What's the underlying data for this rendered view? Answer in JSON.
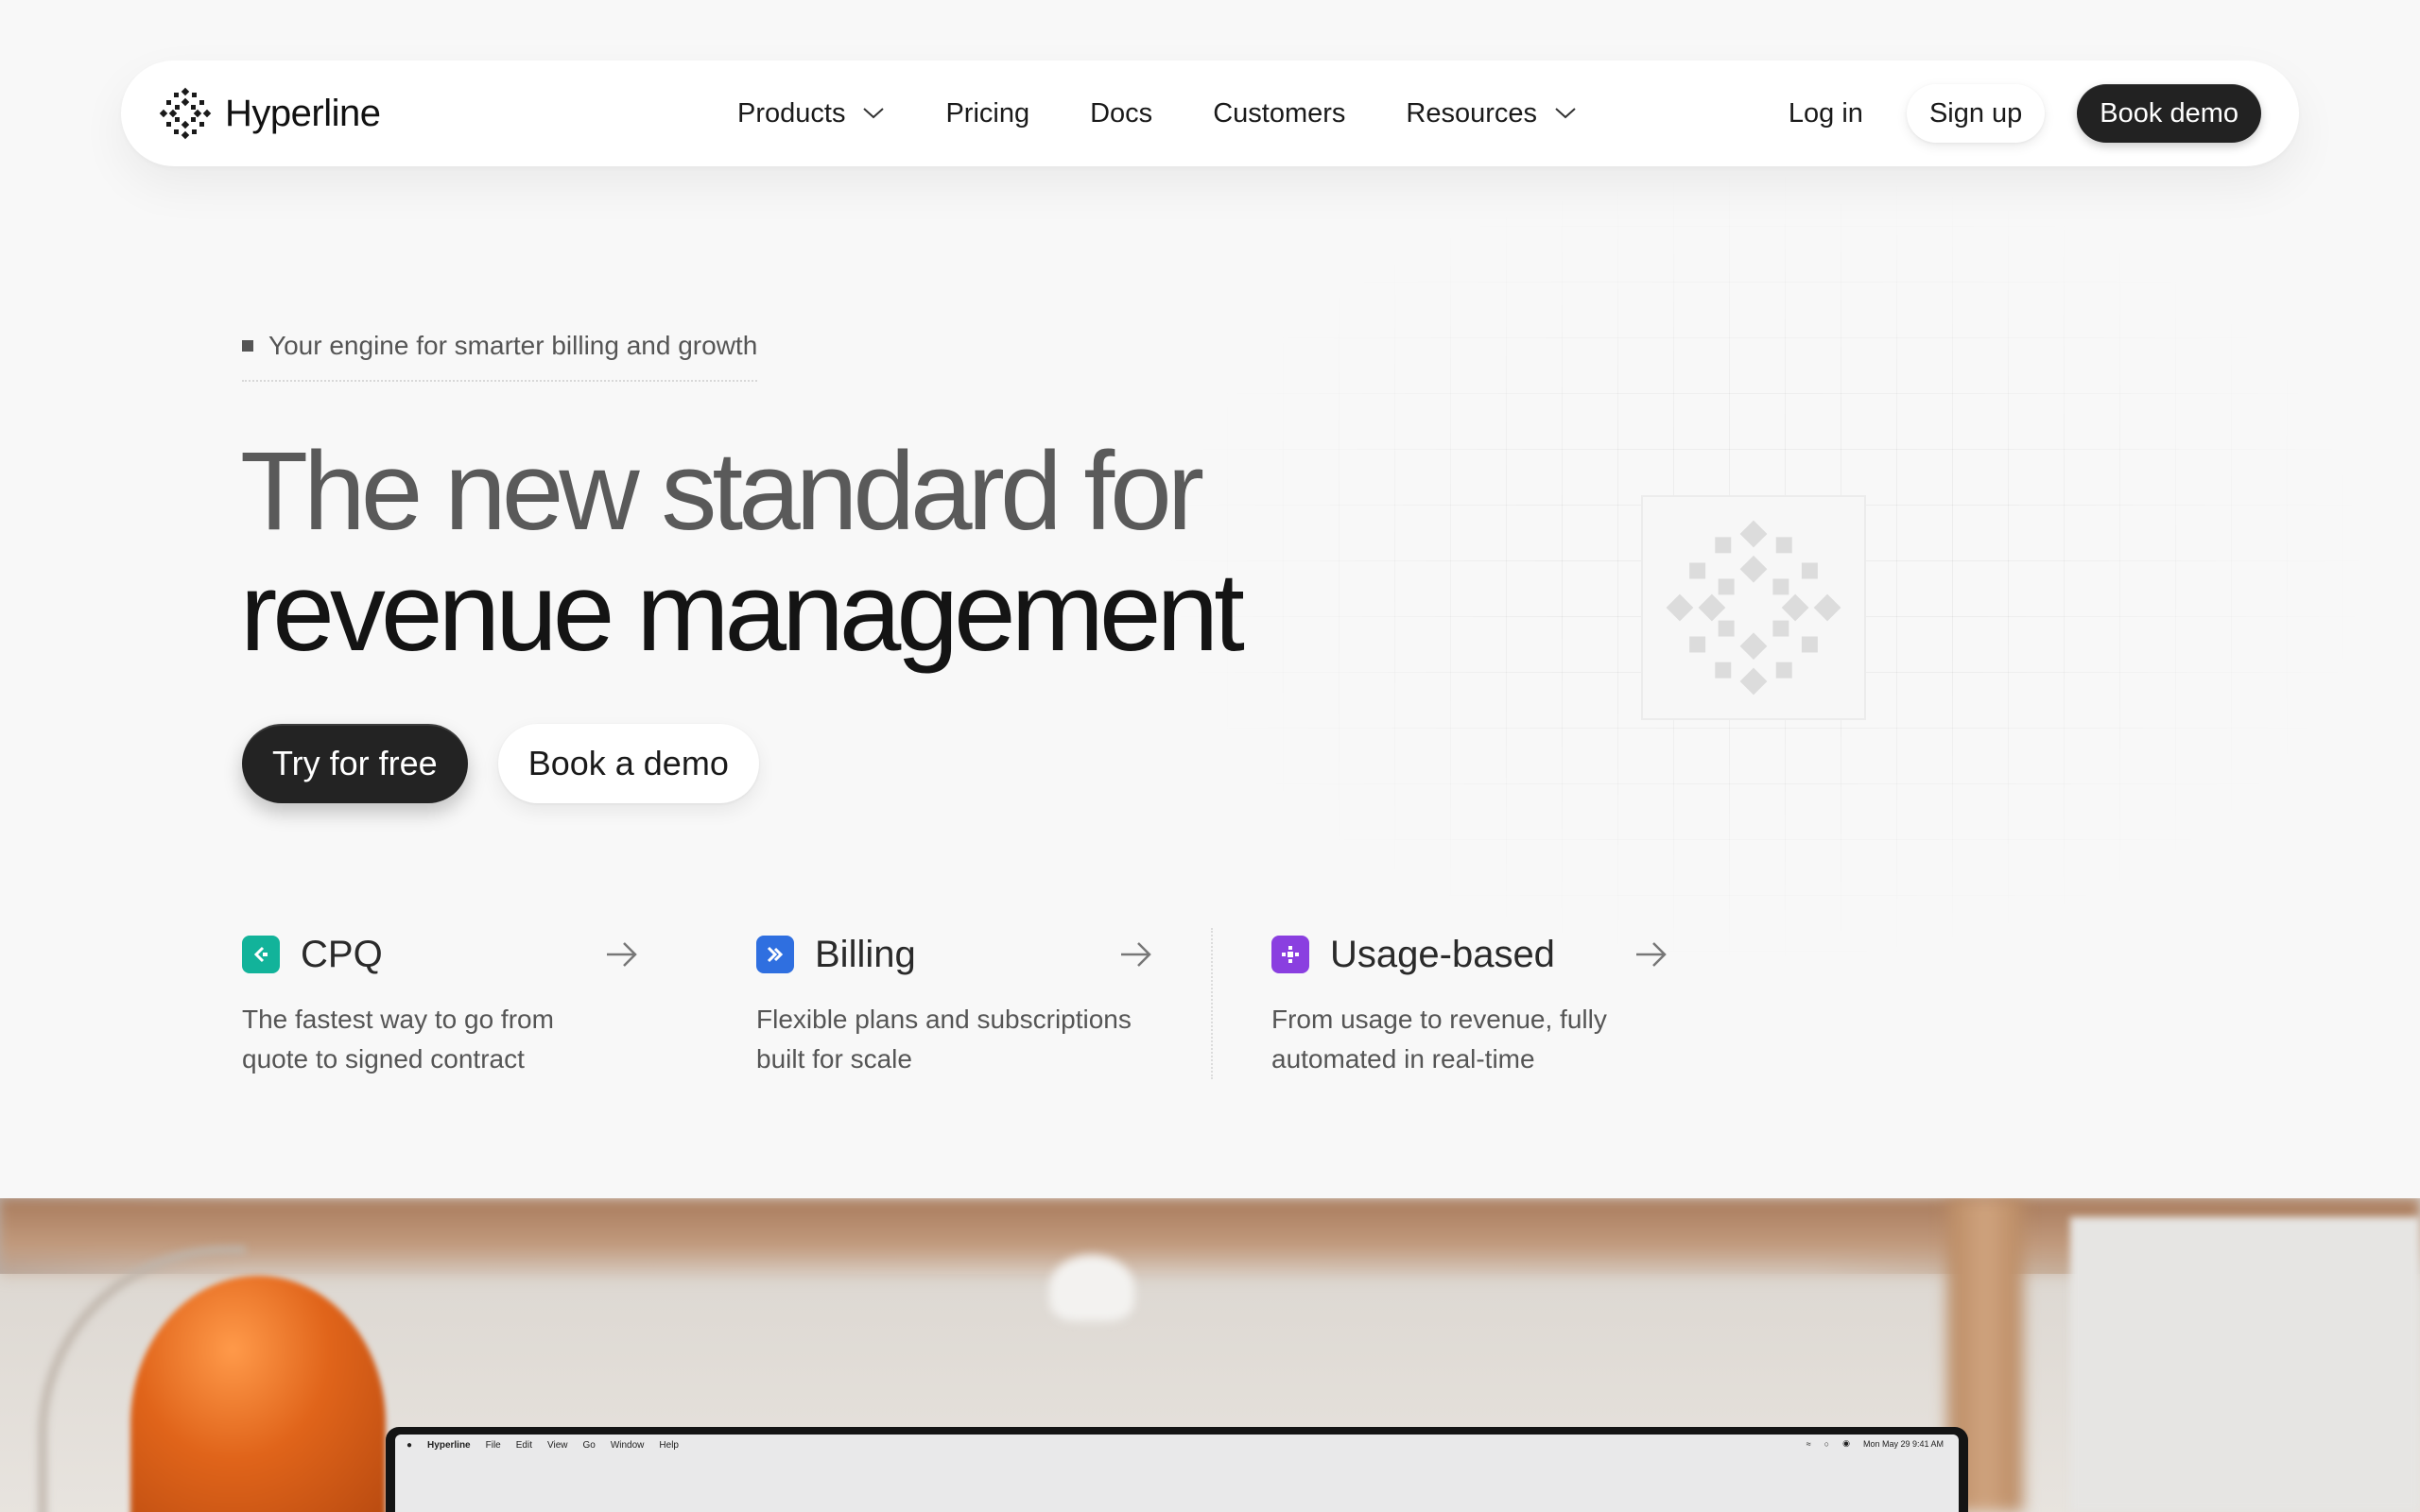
{
  "brand": {
    "name": "Hyperline"
  },
  "nav": {
    "links": [
      {
        "label": "Products",
        "dropdown": true
      },
      {
        "label": "Pricing",
        "dropdown": false
      },
      {
        "label": "Docs",
        "dropdown": false
      },
      {
        "label": "Customers",
        "dropdown": false
      },
      {
        "label": "Resources",
        "dropdown": true
      }
    ],
    "login": "Log in",
    "signup": "Sign up",
    "book_demo": "Book demo"
  },
  "hero": {
    "eyebrow": "Your engine for smarter billing and growth",
    "headline_line1": "The new standard for",
    "headline_line2": "revenue management",
    "cta_primary": "Try for free",
    "cta_secondary": "Book a demo"
  },
  "products": [
    {
      "title": "CPQ",
      "description": "The fastest way to go from quote to signed contract",
      "icon": "cpq-icon",
      "color": "#12b39a"
    },
    {
      "title": "Billing",
      "description": "Flexible plans and subscriptions built for scale",
      "icon": "billing-icon",
      "color": "#2f6fe0"
    },
    {
      "title": "Usage-based",
      "description": "From usage to revenue, fully automated in real-time",
      "icon": "usage-icon",
      "color": "#8a3fe0"
    }
  ],
  "screen": {
    "menubar": [
      "Hyperline",
      "File",
      "Edit",
      "View",
      "Go",
      "Window",
      "Help"
    ],
    "clock": "Mon May 29  9:41 AM"
  },
  "colors": {
    "background": "#f8f8f8",
    "dark_button": "#232323",
    "accent_cpq": "#12b39a",
    "accent_billing": "#2f6fe0",
    "accent_usage": "#8a3fe0"
  }
}
